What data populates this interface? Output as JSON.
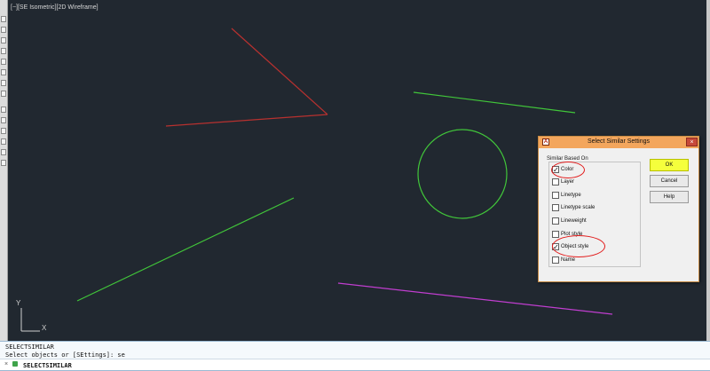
{
  "viewport": {
    "label": "[−][SE Isometric][2D Wireframe]",
    "ucs_y": "Y",
    "ucs_x": "X"
  },
  "dialog": {
    "title": "Select Similar Settings",
    "close_glyph": "×",
    "group_label": "Similar Based On",
    "options": [
      {
        "label": "Color",
        "checked": true
      },
      {
        "label": "Layer",
        "checked": false
      },
      {
        "label": "Linetype",
        "checked": false
      },
      {
        "label": "Linetype scale",
        "checked": false
      },
      {
        "label": "Lineweight",
        "checked": false
      },
      {
        "label": "Plot style",
        "checked": false
      },
      {
        "label": "Object style",
        "checked": true
      },
      {
        "label": "Name",
        "checked": false
      }
    ],
    "ok_label": "OK",
    "cancel_label": "Cancel",
    "help_label": "Help"
  },
  "command": {
    "history_1": "SELECTSIMILAR",
    "history_2": "Select objects or [SEttings]: se",
    "input": "SELECTSIMILAR"
  },
  "colors": {
    "viewport_bg": "#212830",
    "red_line": "#b8312f",
    "green_line": "#41c63a",
    "magenta_line": "#c13ed0",
    "ok_highlight": "#f5ff3c",
    "annotation": "#e21b1b"
  }
}
